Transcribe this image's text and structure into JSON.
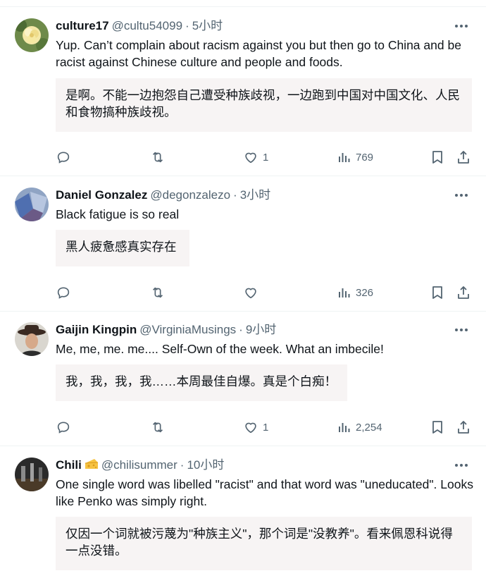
{
  "tweets": [
    {
      "name": "culture17",
      "handle": "@cultu54099",
      "time": "5小时",
      "text": "Yup. Can’t complain about racism against you but then go to China and be racist against Chinese culture and people and foods.",
      "translation": "是啊。不能一边抱怨自己遭受种族歧视，一边跑到中国对中国文化、人民和食物搞种族歧视。",
      "likes": "1",
      "views": "769"
    },
    {
      "name": "Daniel Gonzalez",
      "handle": "@degonzalezo",
      "time": "3小时",
      "text": "Black fatigue is so real",
      "translation": "黑人疲惫感真实存在",
      "likes": "",
      "views": "326"
    },
    {
      "name": "Gaijin Kingpin",
      "handle": "@VirginiaMusings",
      "time": "9小时",
      "text": "Me, me, me. me.... Self-Own of the week. What an imbecile!",
      "translation": "我，我，我，我……本周最佳自爆。真是个白痴！",
      "likes": "1",
      "views": "2,254"
    },
    {
      "name": "Chili",
      "handle": "@chilisummer",
      "time": "10小时",
      "text": "One single word was libelled \"racist\" and that word was \"uneducated\". Looks like Penko was simply right.",
      "translation": "仅因一个词就被污蔑为\"种族主义\"，那个词是\"没教养\"。看来佩恩科说得一点没错。",
      "likes": "",
      "views": ""
    }
  ],
  "icons": {
    "reply": "reply-icon",
    "retweet": "retweet-icon",
    "like": "heart-icon",
    "views": "views-icon",
    "bookmark": "bookmark-icon",
    "share": "share-icon",
    "more": "more-icon",
    "badge": "cheese-emoji-icon"
  },
  "colors": {
    "text": "#0f1419",
    "secondary": "#536471",
    "translation_bg": "#f7f4f4",
    "divider": "#eff3f4"
  }
}
